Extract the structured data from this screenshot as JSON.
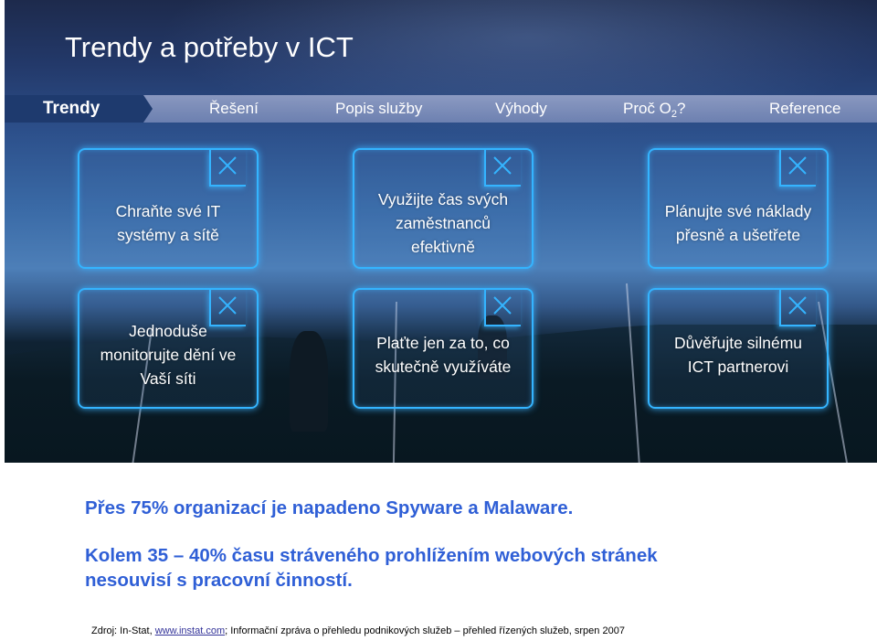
{
  "slide": {
    "title": "Trendy a potřeby v ICT"
  },
  "nav": {
    "items": [
      {
        "label": "Trendy",
        "active": true
      },
      {
        "label": "Řešení",
        "active": false
      },
      {
        "label": "Popis služby",
        "active": false
      },
      {
        "label": "Výhody",
        "active": false
      },
      {
        "label_main": "Proč O",
        "label_sub": "2",
        "label_tail": "?",
        "active": false
      },
      {
        "label": "Reference",
        "active": false
      }
    ],
    "active_color": "#1e3a6e"
  },
  "cards": [
    {
      "text": "Chraňte své IT\nsystémy a sítě",
      "icon": "close-x-icon"
    },
    {
      "text": "Využijte čas svých\nzaměstnanců\nefektivně",
      "icon": "close-x-icon"
    },
    {
      "text": "Plánujte své náklady\npřesně a ušetřete",
      "icon": "close-x-icon"
    },
    {
      "text": "Jednoduše\nmonitorujte dění ve\nVaší síti",
      "icon": "close-x-icon"
    },
    {
      "text": "Plaťte jen za to, co\nskutečně využíváte",
      "icon": "close-x-icon"
    },
    {
      "text": "Důvěřujte silnému\nICT partnerovi",
      "icon": "close-x-icon"
    }
  ],
  "facts": [
    "Přes 75% organizací je napadeno Spyware a Malaware.",
    "Kolem 35 – 40% času stráveného prohlížením webových stránek\nnesouvisí s pracovní činností."
  ],
  "source": {
    "prefix": "Zdroj: In-Stat, ",
    "link": "www.instat.com",
    "suffix": "; Informační zpráva o přehledu podnikových služeb – přehled řízených služeb, srpen 2007"
  },
  "colors": {
    "accent_glow": "#34b4ff",
    "fact_text": "#2f5fd6"
  }
}
